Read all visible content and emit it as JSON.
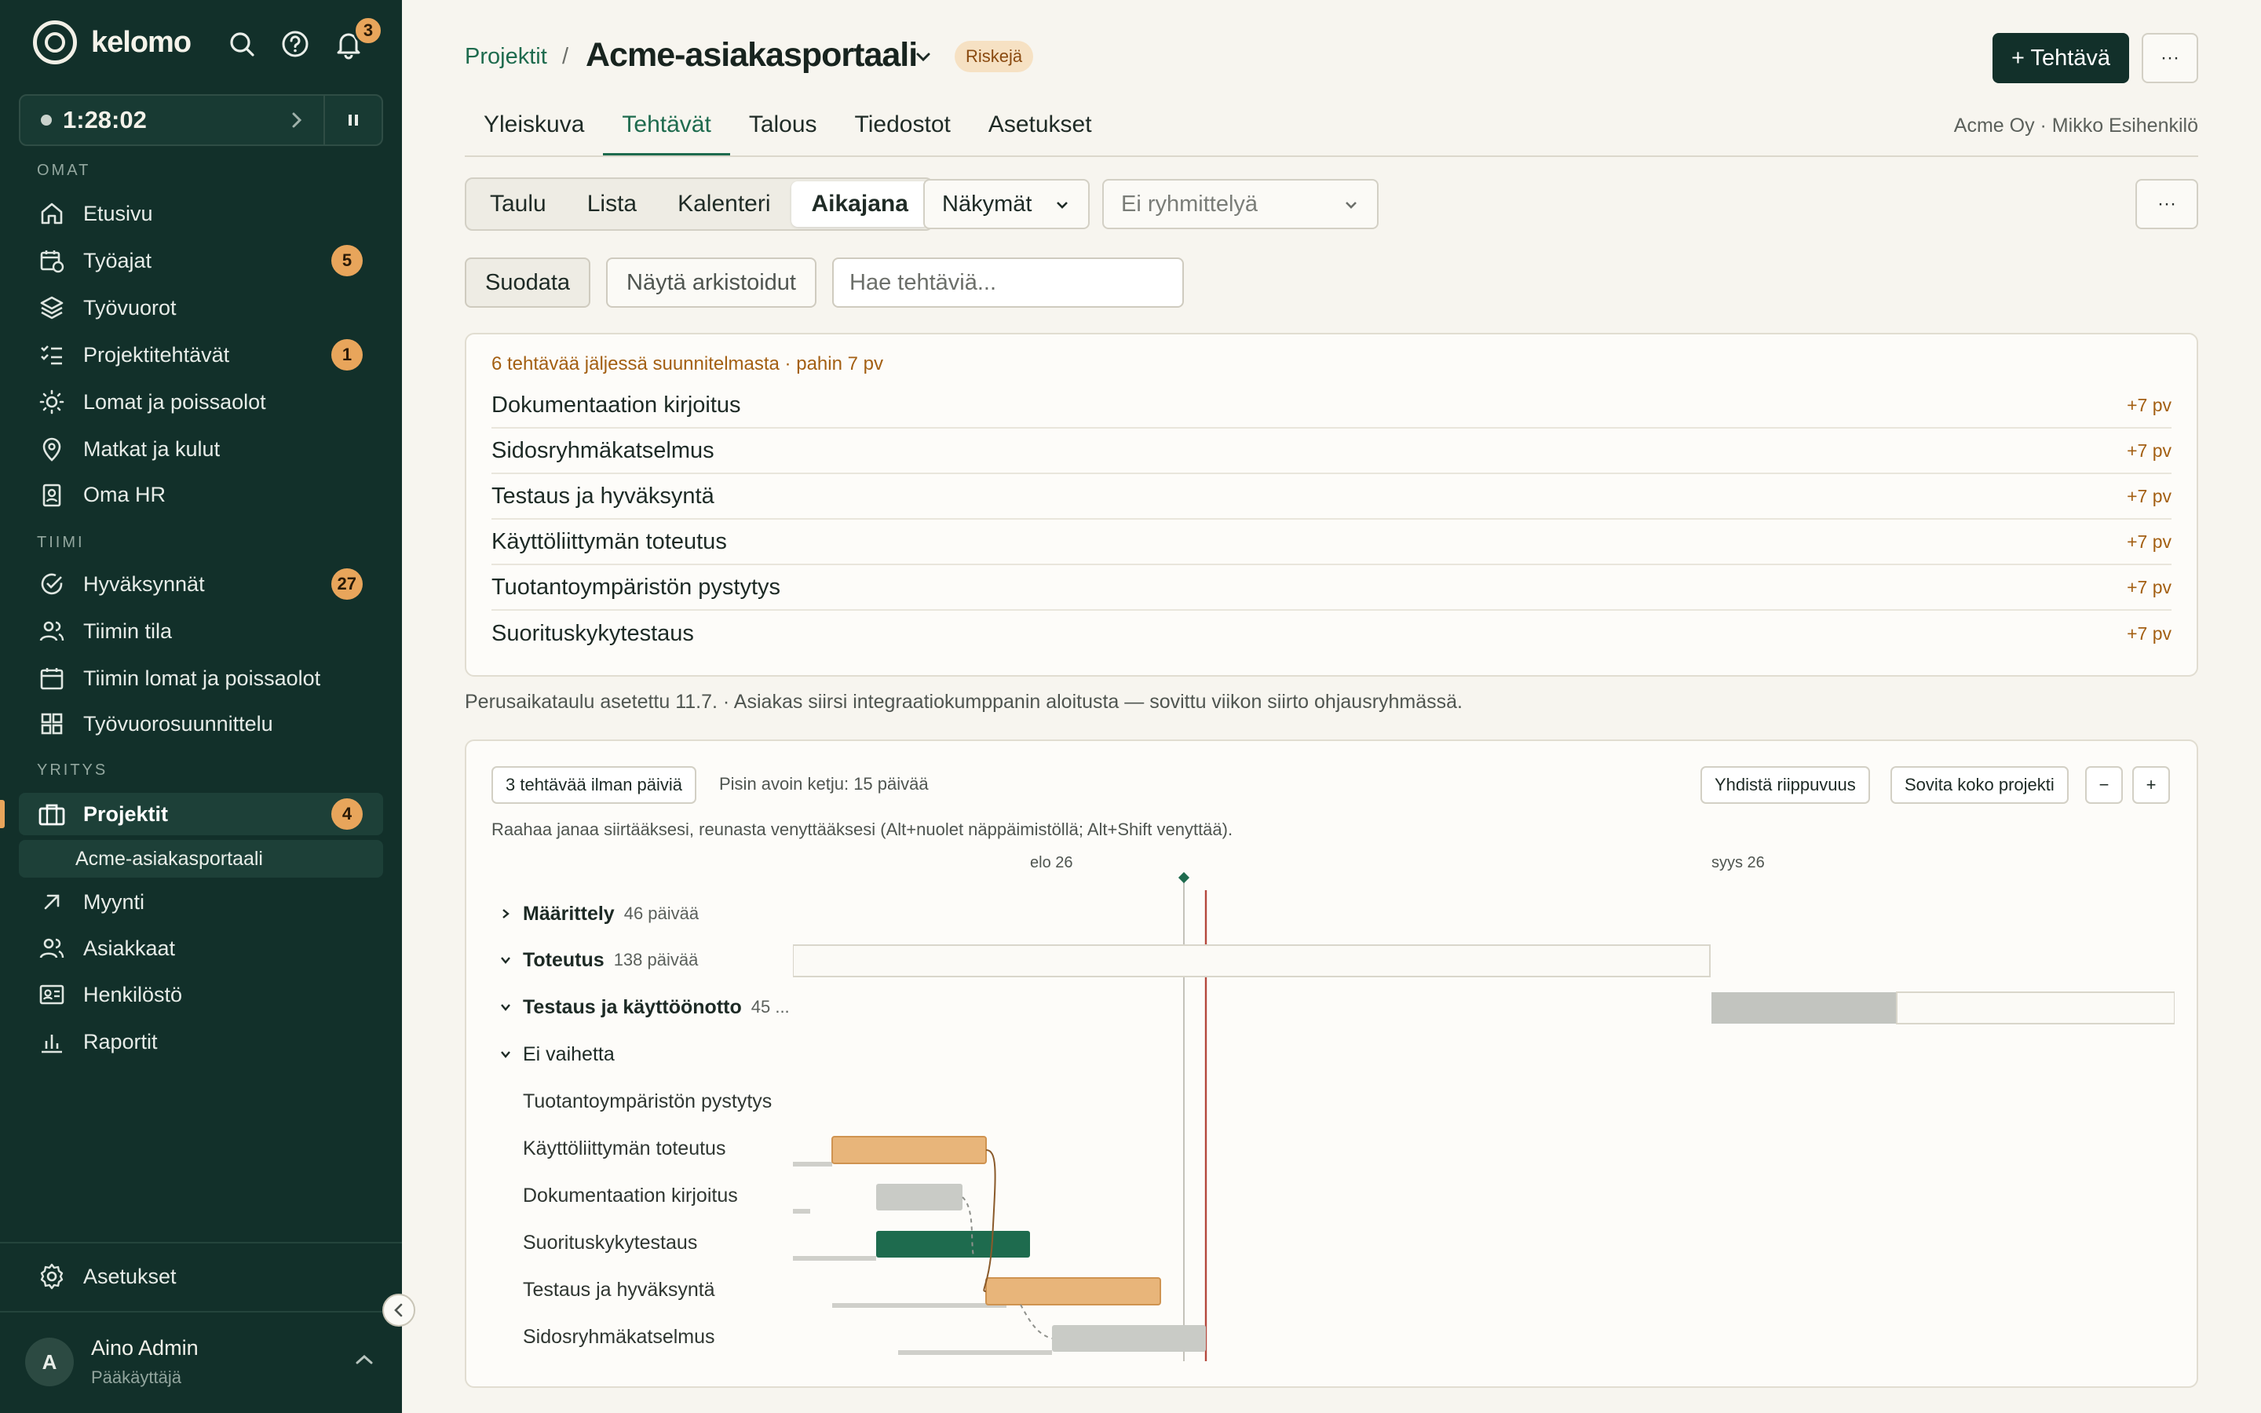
{
  "brand": {
    "name": "kelomo",
    "notifications": "3"
  },
  "timer": {
    "elapsed": "1:28:02"
  },
  "sidebar": {
    "sections": {
      "omat": "OMAT",
      "tiimi": "TIIMI",
      "yritys": "YRITYS"
    },
    "items": [
      {
        "label": "Etusivu",
        "icon": "home-icon"
      },
      {
        "label": "Työajat",
        "icon": "calendar-clock-icon",
        "badge": "5"
      },
      {
        "label": "Työvuorot",
        "icon": "layers-icon"
      },
      {
        "label": "Projektitehtävät",
        "icon": "checklist-icon",
        "badge": "1"
      },
      {
        "label": "Lomat ja poissaolot",
        "icon": "sun-icon"
      },
      {
        "label": "Matkat ja kulut",
        "icon": "map-pin-icon"
      },
      {
        "label": "Oma HR",
        "icon": "id-badge-icon"
      },
      {
        "label": "Hyväksynnät",
        "icon": "check-circle-icon",
        "badge": "27"
      },
      {
        "label": "Tiimin tila",
        "icon": "users-icon"
      },
      {
        "label": "Tiimin lomat ja poissaolot",
        "icon": "calendar-icon"
      },
      {
        "label": "Työvuorosuunnittelu",
        "icon": "grid-icon"
      },
      {
        "label": "Projektit",
        "icon": "briefcase-icon",
        "badge": "4"
      },
      {
        "label": "Myynti",
        "icon": "arrow-up-right-icon"
      },
      {
        "label": "Asiakkaat",
        "icon": "users-icon"
      },
      {
        "label": "Henkilöstö",
        "icon": "id-card-icon"
      },
      {
        "label": "Raportit",
        "icon": "bar-chart-icon"
      }
    ],
    "sub_item": "Acme-asiakasportaali",
    "settings": "Asetukset",
    "user": {
      "initial": "A",
      "name": "Aino Admin",
      "role": "Pääkäyttäjä"
    }
  },
  "header": {
    "breadcrumb": "Projektit",
    "separator": "/",
    "title": "Acme-asiakasportaali",
    "status_badge": "Riskejä",
    "add_button": "+ Tehtävä",
    "more": "···",
    "client": "Acme Oy · Mikko Esihenkilö"
  },
  "tabs": [
    "Yleiskuva",
    "Tehtävät",
    "Talous",
    "Tiedostot",
    "Asetukset"
  ],
  "views": [
    "Taulu",
    "Lista",
    "Kalenteri",
    "Aikajana"
  ],
  "views_dropdown": "Näkymät",
  "grouping_placeholder": "Ei ryhmittelyä",
  "toolbar": {
    "filter": "Suodata",
    "show_archived": "Näytä arkistoidut",
    "search_placeholder": "Hae tehtäviä..."
  },
  "late": {
    "heading": "6 tehtävää jäljessä suunnitelmasta · pahin 7 pv",
    "rows": [
      {
        "task": "Dokumentaation kirjoitus",
        "delay": "+7 pv"
      },
      {
        "task": "Sidosryhmäkatselmus",
        "delay": "+7 pv"
      },
      {
        "task": "Testaus ja hyväksyntä",
        "delay": "+7 pv"
      },
      {
        "task": "Käyttöliittymän toteutus",
        "delay": "+7 pv"
      },
      {
        "task": "Tuotantoympäristön pystytys",
        "delay": "+7 pv"
      },
      {
        "task": "Suorituskykytestaus",
        "delay": "+7 pv"
      }
    ]
  },
  "note": "Perusaikataulu asetettu 11.7. · Asiakas siirsi integraatiokumppanin aloitusta — sovittu viikon siirto ohjausryhmässä.",
  "timeline": {
    "no_dates_chip": "3 tehtävää ilman päiviä",
    "critical_path": "Pisin avoin ketju: 15 päivää",
    "link_dependency": "Yhdistä riippuvuus",
    "fit_project": "Sovita koko projekti",
    "zoom_out": "−",
    "zoom_in": "+",
    "hint": "Raahaa janaa siirtääksesi, reunasta venyttääksesi (Alt+nuolet näppäimistöllä; Alt+Shift venyttää).",
    "axis": [
      "elo 26",
      "syys 26"
    ],
    "phases": [
      {
        "name": "Määrittely",
        "duration": "46 päivää",
        "expanded": false
      },
      {
        "name": "Toteutus",
        "duration": "138 päivää",
        "expanded": true
      },
      {
        "name": "Testaus ja käyttöönotto",
        "duration": "45 ...",
        "expanded": true
      },
      {
        "name": "Ei vaihetta",
        "duration": "",
        "expanded": true
      }
    ],
    "tasks": [
      {
        "name": "Tuotantoympäristön pystytys",
        "status": "none"
      },
      {
        "name": "Käyttöliittymän toteutus",
        "status": "late"
      },
      {
        "name": "Dokumentaation kirjoitus",
        "status": "planned"
      },
      {
        "name": "Suorituskykytestaus",
        "status": "in-progress"
      },
      {
        "name": "Testaus ja hyväksyntä",
        "status": "late"
      },
      {
        "name": "Sidosryhmäkatselmus",
        "status": "planned"
      }
    ],
    "colors": {
      "late": "#e8b57a",
      "planned": "#c9cbc6",
      "in_progress": "#1e6b4e",
      "today": "#b5483d"
    }
  }
}
